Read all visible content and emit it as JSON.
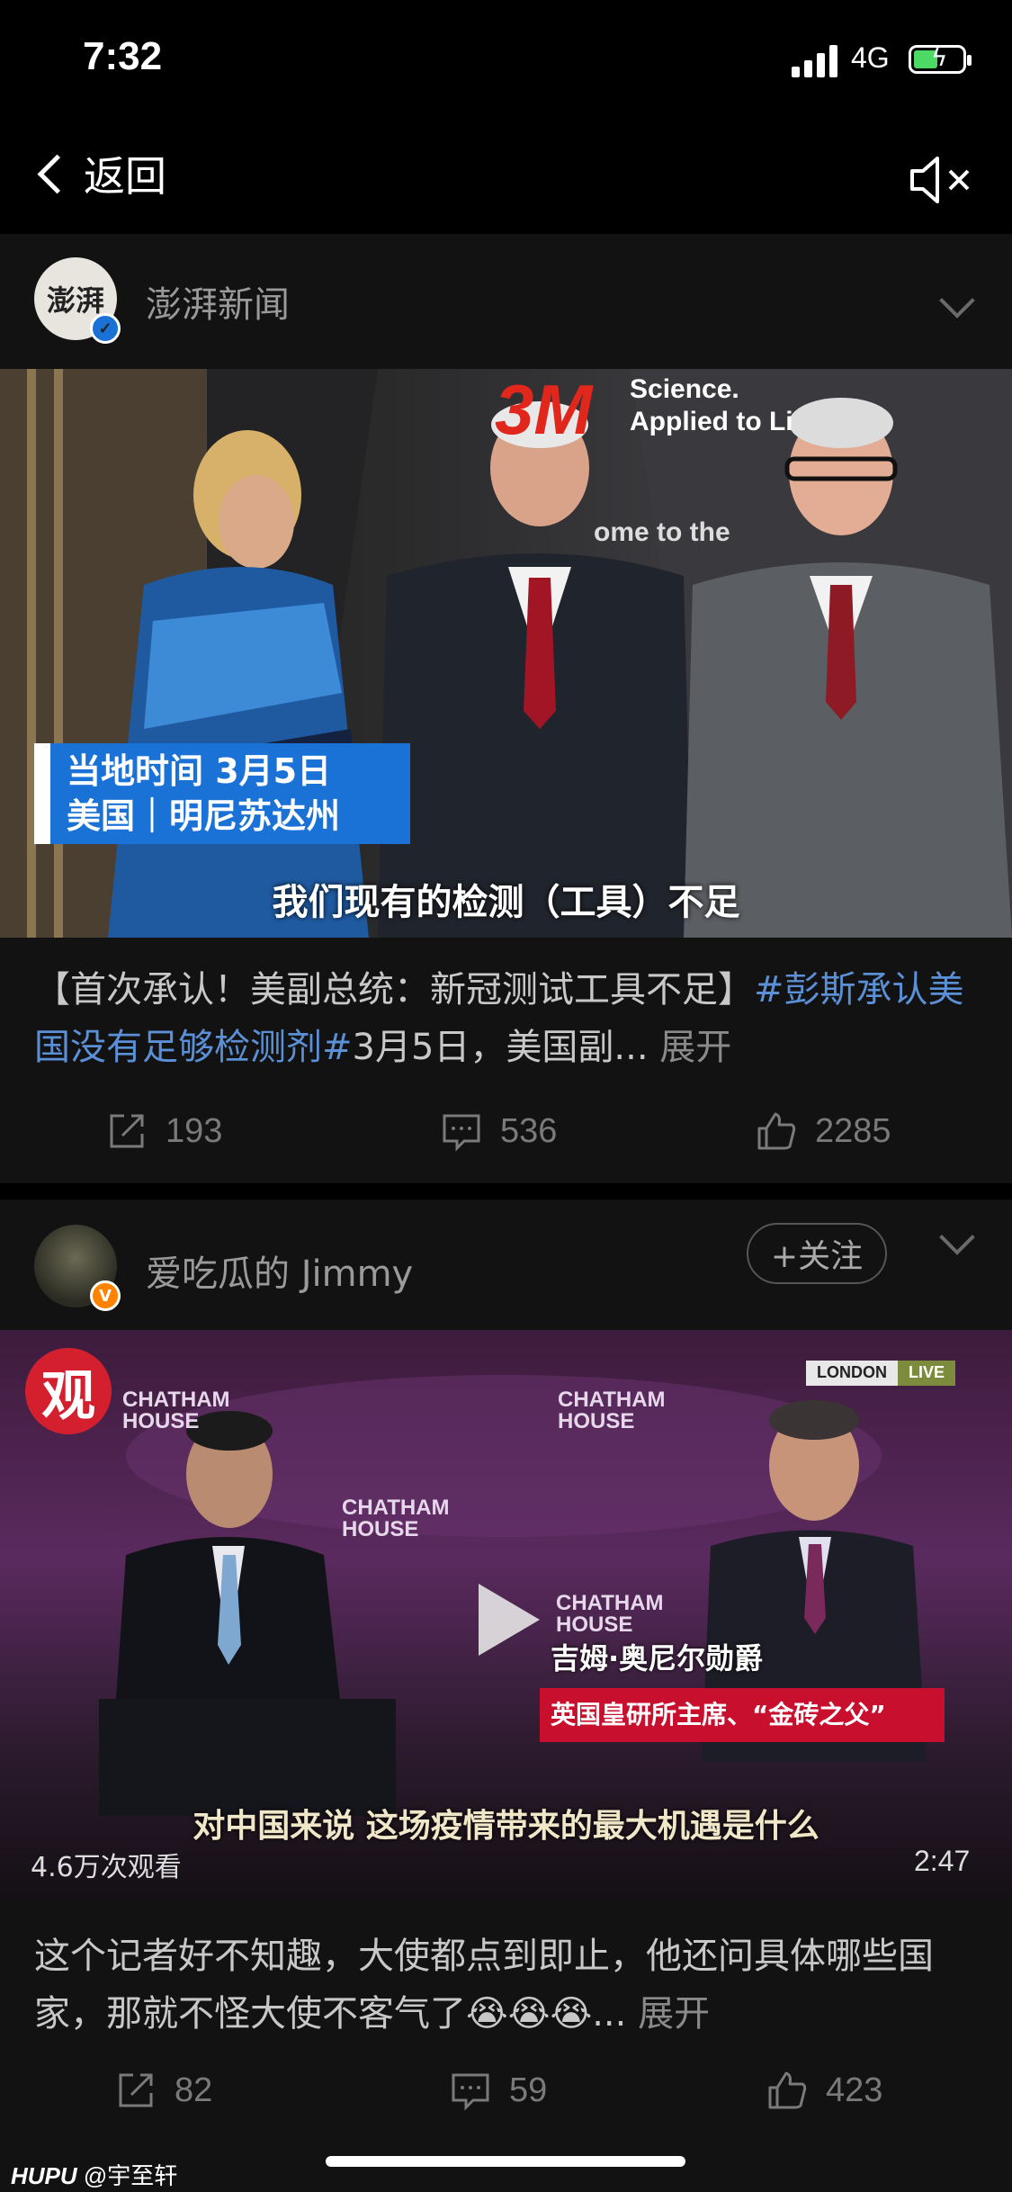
{
  "status": {
    "time": "7:32",
    "network": "4G"
  },
  "nav": {
    "back_label": "返回"
  },
  "posts": [
    {
      "author": "澎湃新闻",
      "avatar_text": "澎湃",
      "video": {
        "badge_line1": "当地时间 3月5日",
        "badge_line2": "美国｜明尼苏达州",
        "subtitle": "我们现有的检测（工具）不足",
        "logo_3m": "3M",
        "logo_text1": "Science.",
        "logo_text2": "Applied to Li",
        "wall_text": "ome to the"
      },
      "caption_plain": "【首次承认！美副总统：新冠测试工具不足】",
      "caption_tag": "#彭斯承认美国没有足够检测剂#",
      "caption_rest": "3月5日，美国副...",
      "more": "展开",
      "shares": "193",
      "comments": "536",
      "likes": "2285"
    },
    {
      "author": "爱吃瓜的 Jimmy",
      "follow": "+关注",
      "video": {
        "channel_logo": "观",
        "chatham": "CHATHAM",
        "house": "HOUSE",
        "london": "LONDON",
        "live": "LIVE",
        "name_label": "吉姆·奥尼尔勋爵",
        "role_label": "英国皇研所主席、“金砖之父”",
        "subtitle": "对中国来说 这场疫情带来的最大机遇是什么",
        "views": "4.6万次观看",
        "duration": "2:47"
      },
      "caption": "这个记者好不知趣，大使都点到即止，他还问具体哪些国家，那就不怪大使不客气了",
      "emojis": "😭😭😭",
      "caption_end": "...",
      "more": "展开",
      "shares": "82",
      "comments": "59",
      "likes": "423"
    }
  ],
  "watermark": {
    "brand": "HUPU",
    "user": "@宇至轩"
  },
  "colors": {
    "link": "#5b8fd6",
    "badge_blue": "#1a72d6",
    "red_label": "#c8102e",
    "verified": "#ff8200"
  }
}
